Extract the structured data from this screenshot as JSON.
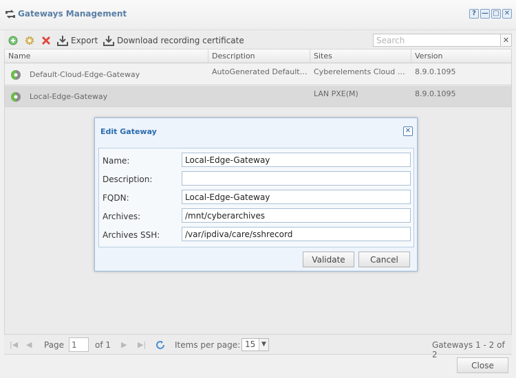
{
  "window": {
    "title": "Gateways Management",
    "controls": [
      "?",
      "—",
      "□",
      "✕"
    ]
  },
  "toolbar": {
    "export_label": "Export",
    "download_cert_label": "Download recording certificate",
    "search_placeholder": "Search",
    "search_clear": "✕"
  },
  "grid": {
    "columns": [
      "Name",
      "Description",
      "Sites",
      "Version"
    ],
    "rows": [
      {
        "name": "Default-Cloud-Edge-Gateway",
        "description": "AutoGenerated Default…",
        "sites": "Cyberelements Cloud …",
        "version": "8.9.0.1095"
      },
      {
        "name": "Local-Edge-Gateway",
        "description": "",
        "sites": "LAN PXE(M)",
        "version": "8.9.0.1095"
      }
    ]
  },
  "pager": {
    "page_label": "Page",
    "page_value": "1",
    "of_label": "of 1",
    "items_per_page_label": "Items per page:",
    "items_per_page_value": "15",
    "summary": "Gateways 1 - 2 of 2"
  },
  "footer": {
    "close_label": "Close"
  },
  "dialog": {
    "title": "Edit Gateway",
    "close_glyph": "✕",
    "fields": {
      "name": {
        "label": "Name:",
        "value": "Local-Edge-Gateway"
      },
      "description": {
        "label": "Description:",
        "value": ""
      },
      "fqdn": {
        "label": "FQDN:",
        "value": "Local-Edge-Gateway"
      },
      "archives": {
        "label": "Archives:",
        "value": "/mnt/cyberarchives"
      },
      "archives_ssh": {
        "label": "Archives SSH:",
        "value": "/var/ipdiva/care/sshrecord"
      }
    },
    "validate_label": "Validate",
    "cancel_label": "Cancel"
  },
  "colors": {
    "accent": "#2a6bb0",
    "title": "#5a7fa6",
    "selected_row": "#dadada",
    "add_green": "#5cb85c",
    "delete_red": "#e0483e"
  }
}
